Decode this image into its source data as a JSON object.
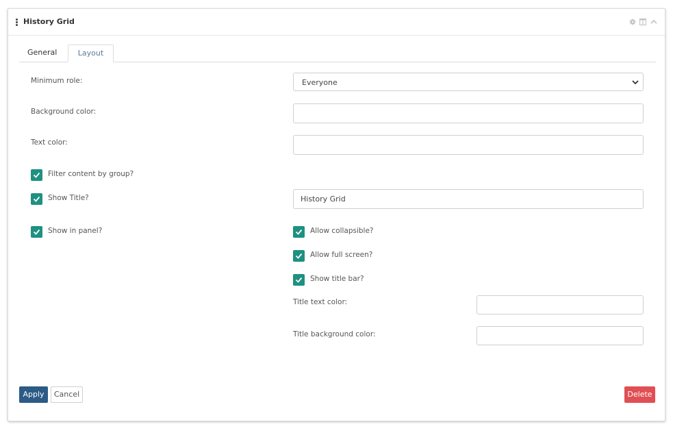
{
  "panel": {
    "title": "History Grid",
    "header_icons": [
      "gear-icon",
      "window-icon",
      "chevron-up-icon"
    ]
  },
  "tabs": [
    {
      "label": "General",
      "active": false
    },
    {
      "label": "Layout",
      "active": true
    }
  ],
  "form": {
    "minimum_role": {
      "label": "Minimum role:",
      "value": "Everyone"
    },
    "background_color": {
      "label": "Background color:",
      "value": ""
    },
    "text_color": {
      "label": "Text color:",
      "value": ""
    },
    "filter_by_group": {
      "label": "Filter content by group?",
      "checked": true
    },
    "show_title": {
      "label": "Show Title?",
      "checked": true,
      "title_value": "History Grid"
    },
    "show_in_panel": {
      "label": "Show in panel?",
      "checked": true
    },
    "allow_collapsible": {
      "label": "Allow collapsible?",
      "checked": true
    },
    "allow_full_screen": {
      "label": "Allow full screen?",
      "checked": true
    },
    "show_title_bar": {
      "label": "Show title bar?",
      "checked": true
    },
    "title_text_color": {
      "label": "Title text color:",
      "value": ""
    },
    "title_background_color": {
      "label": "Title background color:",
      "value": ""
    }
  },
  "buttons": {
    "apply": "Apply",
    "cancel": "Cancel",
    "delete": "Delete"
  },
  "colors": {
    "checkbox": "#1e9180",
    "apply": "#2c5b86",
    "delete": "#e04f53"
  }
}
